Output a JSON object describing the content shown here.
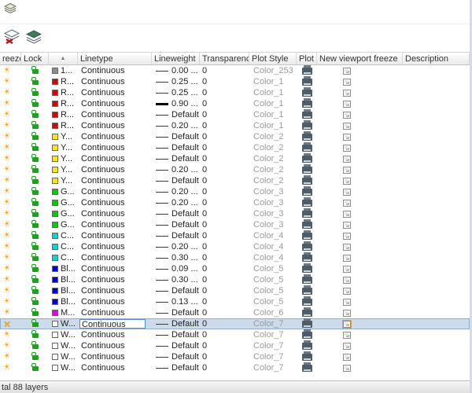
{
  "toolbar": {
    "buttons": [
      {
        "id": "layer-filter",
        "icon": "layers-filter-icon"
      },
      {
        "id": "delete-layer",
        "icon": "delete-layer-icon"
      },
      {
        "id": "layer-states",
        "icon": "layer-states-icon"
      }
    ]
  },
  "table": {
    "columns": [
      {
        "key": "freeze",
        "label": "reeze"
      },
      {
        "key": "lock",
        "label": "Lock"
      },
      {
        "key": "color",
        "label": "",
        "sort": "asc"
      },
      {
        "key": "linetype",
        "label": "Linetype"
      },
      {
        "key": "lineweight",
        "label": "Lineweight"
      },
      {
        "key": "transparency",
        "label": "Transparency"
      },
      {
        "key": "plot_style",
        "label": "Plot Style"
      },
      {
        "key": "plot",
        "label": "Plot"
      },
      {
        "key": "new_vp_freeze",
        "label": "New viewport freeze"
      },
      {
        "key": "description",
        "label": "Description"
      }
    ],
    "rows": [
      {
        "freeze": "on",
        "lock": "unlocked",
        "color": "#8c8c8c",
        "color_label": "1...",
        "linetype": "Continuous",
        "lineweight": "0.00 ...",
        "thick": false,
        "transparency": "0",
        "plot_style": "Color_253",
        "plot": "on",
        "selected": false
      },
      {
        "freeze": "on",
        "lock": "unlocked",
        "color": "#dd0000",
        "color_label": "R...",
        "linetype": "Continuous",
        "lineweight": "0.25 ...",
        "thick": false,
        "transparency": "0",
        "plot_style": "Color_1",
        "plot": "on",
        "selected": false
      },
      {
        "freeze": "on",
        "lock": "unlocked",
        "color": "#dd0000",
        "color_label": "R...",
        "linetype": "Continuous",
        "lineweight": "0.25 ...",
        "thick": false,
        "transparency": "0",
        "plot_style": "Color_1",
        "plot": "on",
        "selected": false
      },
      {
        "freeze": "on",
        "lock": "unlocked",
        "color": "#dd0000",
        "color_label": "R...",
        "linetype": "Continuous",
        "lineweight": "0.90 ...",
        "thick": true,
        "transparency": "0",
        "plot_style": "Color_1",
        "plot": "on",
        "selected": false
      },
      {
        "freeze": "on",
        "lock": "unlocked",
        "color": "#dd0000",
        "color_label": "R...",
        "linetype": "Continuous",
        "lineweight": "Default",
        "thick": false,
        "transparency": "0",
        "plot_style": "Color_1",
        "plot": "on",
        "selected": false
      },
      {
        "freeze": "on",
        "lock": "unlocked",
        "color": "#dd0000",
        "color_label": "R...",
        "linetype": "Continuous",
        "lineweight": "0.20 ...",
        "thick": false,
        "transparency": "0",
        "plot_style": "Color_1",
        "plot": "on",
        "selected": false
      },
      {
        "freeze": "on",
        "lock": "unlocked",
        "color": "#ffe600",
        "color_label": "Y...",
        "linetype": "Continuous",
        "lineweight": "Default",
        "thick": false,
        "transparency": "0",
        "plot_style": "Color_2",
        "plot": "on",
        "selected": false
      },
      {
        "freeze": "on",
        "lock": "unlocked",
        "color": "#ffe600",
        "color_label": "Y...",
        "linetype": "Continuous",
        "lineweight": "Default",
        "thick": false,
        "transparency": "0",
        "plot_style": "Color_2",
        "plot": "on",
        "selected": false
      },
      {
        "freeze": "on",
        "lock": "unlocked",
        "color": "#ffe600",
        "color_label": "Y...",
        "linetype": "Continuous",
        "lineweight": "Default",
        "thick": false,
        "transparency": "0",
        "plot_style": "Color_2",
        "plot": "on",
        "selected": false
      },
      {
        "freeze": "on",
        "lock": "unlocked",
        "color": "#ffe600",
        "color_label": "Y...",
        "linetype": "Continuous",
        "lineweight": "0.20 ...",
        "thick": false,
        "transparency": "0",
        "plot_style": "Color_2",
        "plot": "on",
        "selected": false
      },
      {
        "freeze": "on",
        "lock": "unlocked",
        "color": "#ffe600",
        "color_label": "Y...",
        "linetype": "Continuous",
        "lineweight": "Default",
        "thick": false,
        "transparency": "0",
        "plot_style": "Color_2",
        "plot": "on",
        "selected": false
      },
      {
        "freeze": "on",
        "lock": "unlocked",
        "color": "#00cc00",
        "color_label": "G...",
        "linetype": "Continuous",
        "lineweight": "0.20 ...",
        "thick": false,
        "transparency": "0",
        "plot_style": "Color_3",
        "plot": "on",
        "selected": false
      },
      {
        "freeze": "on",
        "lock": "unlocked",
        "color": "#00cc00",
        "color_label": "G...",
        "linetype": "Continuous",
        "lineweight": "0.20 ...",
        "thick": false,
        "transparency": "0",
        "plot_style": "Color_3",
        "plot": "on",
        "selected": false
      },
      {
        "freeze": "on",
        "lock": "unlocked",
        "color": "#00cc00",
        "color_label": "G...",
        "linetype": "Continuous",
        "lineweight": "Default",
        "thick": false,
        "transparency": "0",
        "plot_style": "Color_3",
        "plot": "on",
        "selected": false
      },
      {
        "freeze": "on",
        "lock": "unlocked",
        "color": "#00cc00",
        "color_label": "G...",
        "linetype": "Continuous",
        "lineweight": "Default",
        "thick": false,
        "transparency": "0",
        "plot_style": "Color_3",
        "plot": "on",
        "selected": false
      },
      {
        "freeze": "on",
        "lock": "unlocked",
        "color": "#00d8d8",
        "color_label": "C...",
        "linetype": "Continuous",
        "lineweight": "Default",
        "thick": false,
        "transparency": "0",
        "plot_style": "Color_4",
        "plot": "on",
        "selected": false
      },
      {
        "freeze": "on",
        "lock": "unlocked",
        "color": "#00d8d8",
        "color_label": "C...",
        "linetype": "Continuous",
        "lineweight": "0.20 ...",
        "thick": false,
        "transparency": "0",
        "plot_style": "Color_4",
        "plot": "on",
        "selected": false
      },
      {
        "freeze": "on",
        "lock": "unlocked",
        "color": "#00d8d8",
        "color_label": "C...",
        "linetype": "Continuous",
        "lineweight": "0.30 ...",
        "thick": false,
        "transparency": "0",
        "plot_style": "Color_4",
        "plot": "on",
        "selected": false
      },
      {
        "freeze": "on",
        "lock": "unlocked",
        "color": "#0000e0",
        "color_label": "Bl...",
        "linetype": "Continuous",
        "lineweight": "0.09 ...",
        "thick": false,
        "transparency": "0",
        "plot_style": "Color_5",
        "plot": "on",
        "selected": false
      },
      {
        "freeze": "on",
        "lock": "unlocked",
        "color": "#0000e0",
        "color_label": "Bl...",
        "linetype": "Continuous",
        "lineweight": "0.30 ...",
        "thick": false,
        "transparency": "0",
        "plot_style": "Color_5",
        "plot": "on",
        "selected": false
      },
      {
        "freeze": "on",
        "lock": "unlocked",
        "color": "#0000e0",
        "color_label": "Bl...",
        "linetype": "Continuous",
        "lineweight": "Default",
        "thick": false,
        "transparency": "0",
        "plot_style": "Color_5",
        "plot": "on",
        "selected": false
      },
      {
        "freeze": "on",
        "lock": "unlocked",
        "color": "#0000e0",
        "color_label": "Bl...",
        "linetype": "Continuous",
        "lineweight": "0.13 ...",
        "thick": false,
        "transparency": "0",
        "plot_style": "Color_5",
        "plot": "on",
        "selected": false
      },
      {
        "freeze": "on",
        "lock": "unlocked",
        "color": "#e800e8",
        "color_label": "M...",
        "linetype": "Continuous",
        "lineweight": "Default",
        "thick": false,
        "transparency": "0",
        "plot_style": "Color_6",
        "plot": "on",
        "selected": false
      },
      {
        "freeze": "frozen",
        "lock": "unlocked",
        "color": "#ffffff",
        "color_label": "W...",
        "linetype": "Continuous",
        "lineweight": "Default",
        "thick": false,
        "transparency": "0",
        "plot_style": "Color_7",
        "plot": "on",
        "selected": true
      },
      {
        "freeze": "on",
        "lock": "unlocked",
        "color": "#ffffff",
        "color_label": "W...",
        "linetype": "Continuous",
        "lineweight": "Default",
        "thick": false,
        "transparency": "0",
        "plot_style": "Color_7",
        "plot": "on",
        "selected": false
      },
      {
        "freeze": "on",
        "lock": "unlocked",
        "color": "#ffffff",
        "color_label": "W...",
        "linetype": "Continuous",
        "lineweight": "Default",
        "thick": false,
        "transparency": "0",
        "plot_style": "Color_7",
        "plot": "on",
        "selected": false
      },
      {
        "freeze": "on",
        "lock": "unlocked",
        "color": "#ffffff",
        "color_label": "W...",
        "linetype": "Continuous",
        "lineweight": "Default",
        "thick": false,
        "transparency": "0",
        "plot_style": "Color_7",
        "plot": "on",
        "selected": false
      },
      {
        "freeze": "on",
        "lock": "unlocked",
        "color": "#ffffff",
        "color_label": "W...",
        "linetype": "Continuous",
        "lineweight": "Default",
        "thick": false,
        "transparency": "0",
        "plot_style": "Color_7",
        "plot": "on",
        "selected": false
      }
    ]
  },
  "status_bar": {
    "text": "tal 88 layers"
  },
  "colors": {
    "selection_bg": "#ccdaeb",
    "sun": "#f0a32c",
    "lock_green": "#1ca21c"
  }
}
